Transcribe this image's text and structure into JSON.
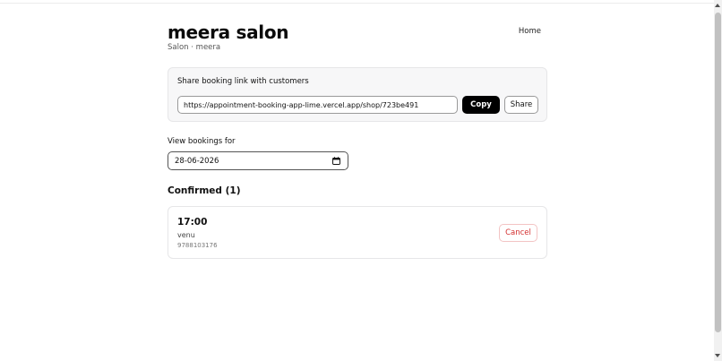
{
  "header": {
    "title": "meera salon",
    "subtitle": "Salon · meera",
    "nav_home": "Home"
  },
  "share": {
    "heading": "Share booking link with customers",
    "link_value": "https://appointment-booking-app-lime.vercel.app/shop/723be491",
    "copy_label": "Copy",
    "share_label": "Share"
  },
  "bookings_filter": {
    "label": "View bookings for",
    "date_value": "28-06-2026"
  },
  "confirmed": {
    "heading": "Confirmed (1)",
    "items": [
      {
        "time": "17:00",
        "name": "venu",
        "phone": "9788103176",
        "cancel_label": "Cancel"
      }
    ]
  },
  "colors": {
    "primary_button": "#000000",
    "cancel_text": "#d32f2f",
    "panel_background": "#f7f7f8"
  },
  "icons": [
    "calendar-icon"
  ]
}
